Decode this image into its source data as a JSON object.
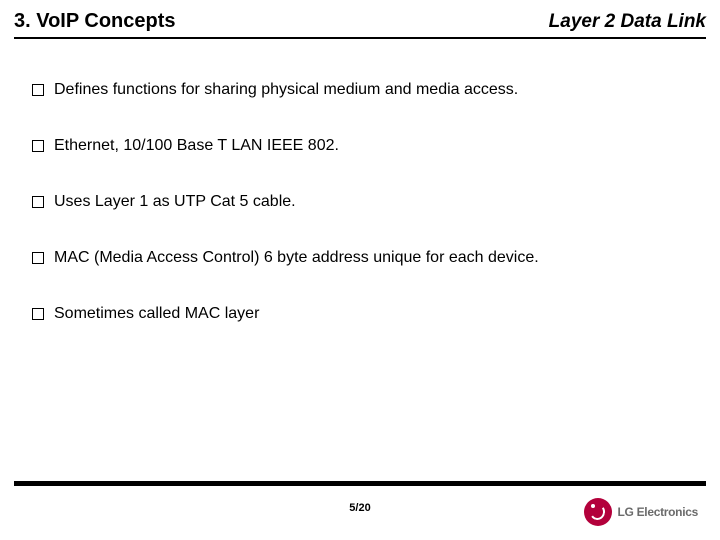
{
  "header": {
    "left": "3. VoIP Concepts",
    "right": "Layer 2 Data Link"
  },
  "bullets": [
    "Defines functions for sharing physical medium and media access.",
    "Ethernet, 10/100 Base T LAN IEEE 802.",
    "Uses Layer 1 as UTP Cat 5 cable.",
    "MAC (Media Access Control) 6 byte address unique for each device.",
    "Sometimes called MAC layer"
  ],
  "footer": {
    "page": "5/20",
    "brand": "LG Electronics"
  }
}
